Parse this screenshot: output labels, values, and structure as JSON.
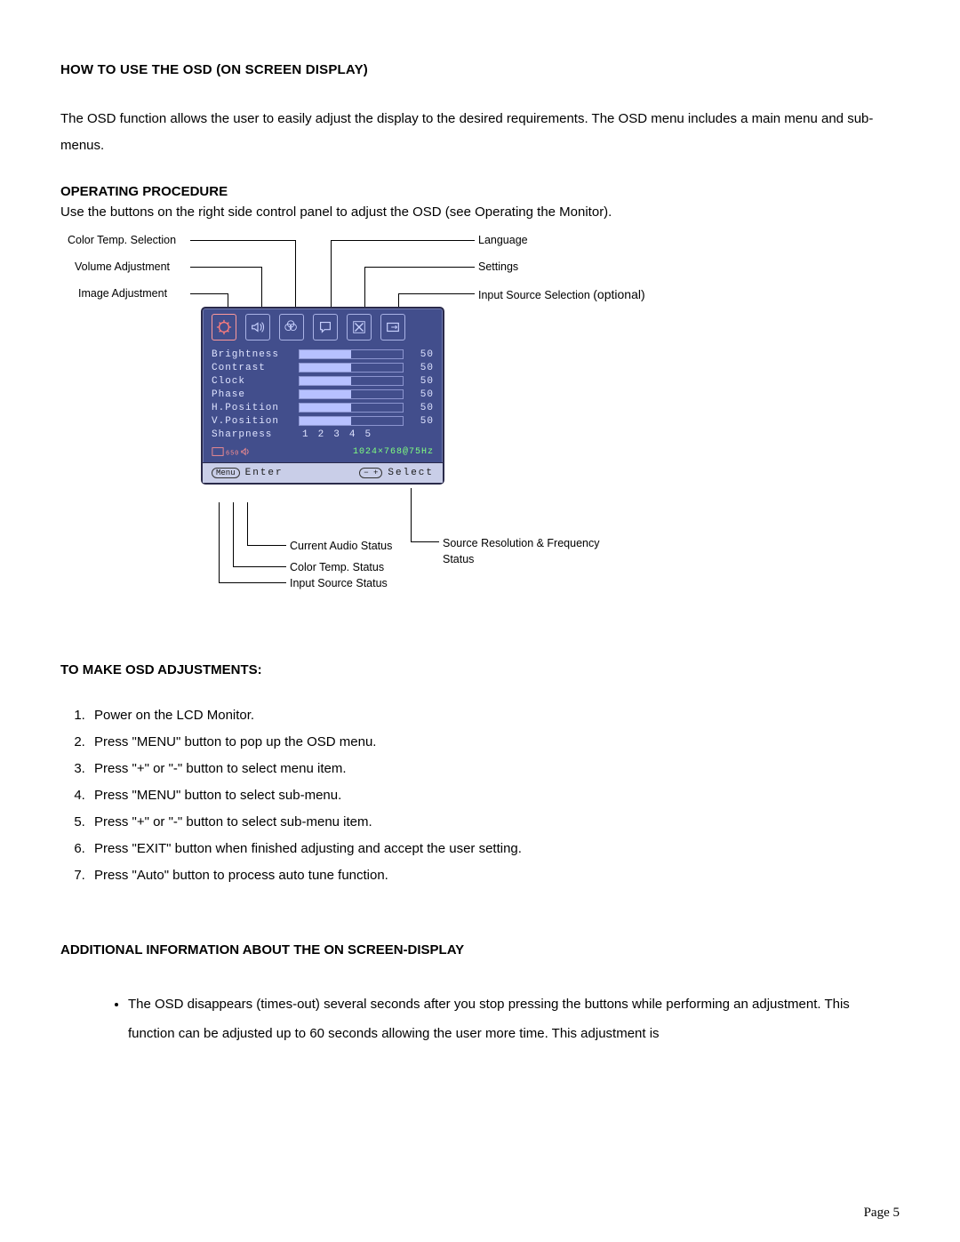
{
  "title": "HOW TO USE THE OSD (ON SCREEN DISPLAY)",
  "intro": "The OSD function allows the user to easily adjust the display to the desired requirements. The OSD menu includes a main menu and sub-menus.",
  "procHeading": "OPERATING PROCEDURE",
  "procText": "Use the buttons on the right side control panel to adjust the OSD (see Operating the Monitor).",
  "diagram": {
    "leftLabels": {
      "colorTemp": "Color  Temp.  Selection",
      "volume": "Volume Adjustment",
      "image": "Image Adjustment"
    },
    "rightLabels": {
      "language": "Language",
      "settings": "Settings",
      "inputSource": "Input Source Selection",
      "inputSourceNote": "(optional)"
    },
    "bottomLabels": {
      "audio": "Current Audio Status",
      "colorTempStatus": "Color Temp. Status",
      "inputSourceStatus": "Input Source Status",
      "resFreq": "Source Resolution  &  Frequency Status"
    }
  },
  "osd": {
    "icons": [
      "image",
      "volume",
      "color-temp",
      "language",
      "settings",
      "input-source"
    ],
    "rows": [
      {
        "name": "Brightness",
        "value": "50",
        "pct": 50
      },
      {
        "name": "Contrast",
        "value": "50",
        "pct": 50
      },
      {
        "name": "Clock",
        "value": "50",
        "pct": 50
      },
      {
        "name": "Phase",
        "value": "50",
        "pct": 50
      },
      {
        "name": "H.Position",
        "value": "50",
        "pct": 50
      },
      {
        "name": "V.Position",
        "value": "50",
        "pct": 50
      }
    ],
    "sharpLabel": "Sharpness",
    "sharpValues": [
      "1",
      "2",
      "3",
      "4",
      "5"
    ],
    "resolution": "1024×768@75Hz",
    "menuChip": "Menu",
    "enter": "Enter",
    "pmChip": "− +",
    "select": "Select"
  },
  "adjHeading": "TO MAKE OSD ADJUSTMENTS:",
  "steps": [
    "Power on the LCD Monitor.",
    "Press \"MENU\" button to pop up the OSD menu.",
    "Press \"+\" or \"-\" button to select menu item.",
    "Press \"MENU\" button to select sub-menu.",
    "Press \"+\" or \"-\" button to select sub-menu item.",
    "Press \"EXIT\" button when finished adjusting and accept the user setting.",
    "Press \"Auto\" button to process auto tune function."
  ],
  "addHeading": "ADDITIONAL INFORMATION ABOUT THE ON SCREEN-DISPLAY",
  "bullets": [
    "The OSD disappears (times-out) several seconds after you stop pressing the buttons while performing an adjustment.  This function can be adjusted up to 60 seconds allowing the user more time. This adjustment is"
  ],
  "pageNum": "Page 5"
}
